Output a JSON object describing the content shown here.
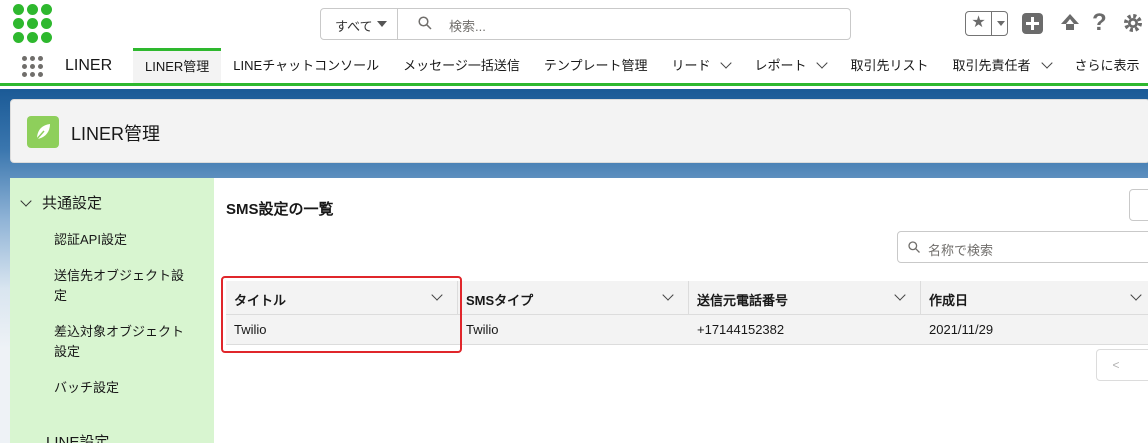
{
  "header": {
    "search_scope": "すべて",
    "search_placeholder": "検索..."
  },
  "nav": {
    "app_name": "LINER",
    "items": [
      {
        "label": "LINER管理",
        "active": true,
        "dropdown": false
      },
      {
        "label": "LINEチャットコンソール",
        "active": false,
        "dropdown": false
      },
      {
        "label": "メッセージ一括送信",
        "active": false,
        "dropdown": false
      },
      {
        "label": "テンプレート管理",
        "active": false,
        "dropdown": false
      },
      {
        "label": "リード",
        "active": false,
        "dropdown": true
      },
      {
        "label": "レポート",
        "active": false,
        "dropdown": true
      },
      {
        "label": "取引先リスト",
        "active": false,
        "dropdown": false
      },
      {
        "label": "取引先責任者",
        "active": false,
        "dropdown": true
      },
      {
        "label": "さらに表示",
        "active": false,
        "dropdown": false
      }
    ]
  },
  "page": {
    "title": "LINER管理"
  },
  "sidebar": {
    "section1": "共通設定",
    "items": [
      "認証API設定",
      "送信先オブジェクト設定",
      "差込対象オブジェクト設定",
      "バッチ設定"
    ],
    "section2": "LINE設定"
  },
  "main": {
    "list_title": "SMS設定の一覧",
    "name_search_placeholder": "名称で検索",
    "columns": [
      "タイトル",
      "SMSタイプ",
      "送信元電話番号",
      "作成日"
    ],
    "rows": [
      [
        "Twilio",
        "Twilio",
        "+17144152382",
        "2021/11/29"
      ]
    ],
    "pager_prev": "<"
  },
  "colors": {
    "brand_green": "#2eb82e",
    "sidebar_bg": "#d8f5d0",
    "highlight_red": "#e0262b"
  }
}
